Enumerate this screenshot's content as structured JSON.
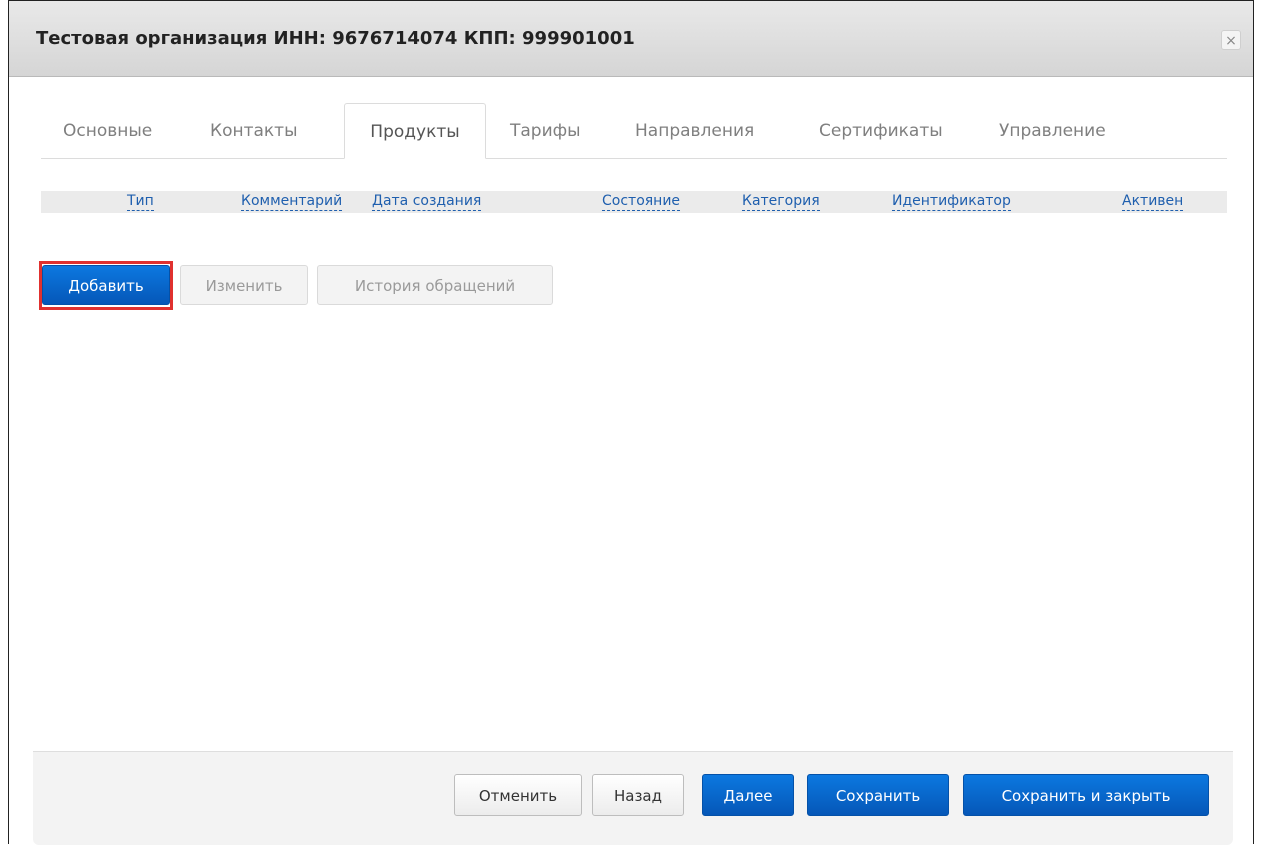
{
  "dialog": {
    "title": "Тестовая организация ИНН: 9676714074 КПП: 999901001",
    "close_symbol": "×"
  },
  "tabs": [
    {
      "label": "Основные"
    },
    {
      "label": "Контакты"
    },
    {
      "label": "Продукты",
      "active": true
    },
    {
      "label": "Тарифы"
    },
    {
      "label": "Направления"
    },
    {
      "label": "Сертификаты"
    },
    {
      "label": "Управление"
    }
  ],
  "table": {
    "columns": [
      "Тип",
      "Комментарий",
      "Дата создания",
      "Состояние",
      "Категория",
      "Идентификатор",
      "Активен"
    ]
  },
  "actions": {
    "add": "Добавить",
    "edit": "Изменить",
    "history": "История обращений"
  },
  "footer": {
    "cancel": "Отменить",
    "back": "Назад",
    "next": "Далее",
    "save": "Сохранить",
    "save_close": "Сохранить и закрыть"
  },
  "colors": {
    "primary": "#0a6ad6",
    "link": "#1f5fae",
    "highlight": "#e0312f"
  }
}
